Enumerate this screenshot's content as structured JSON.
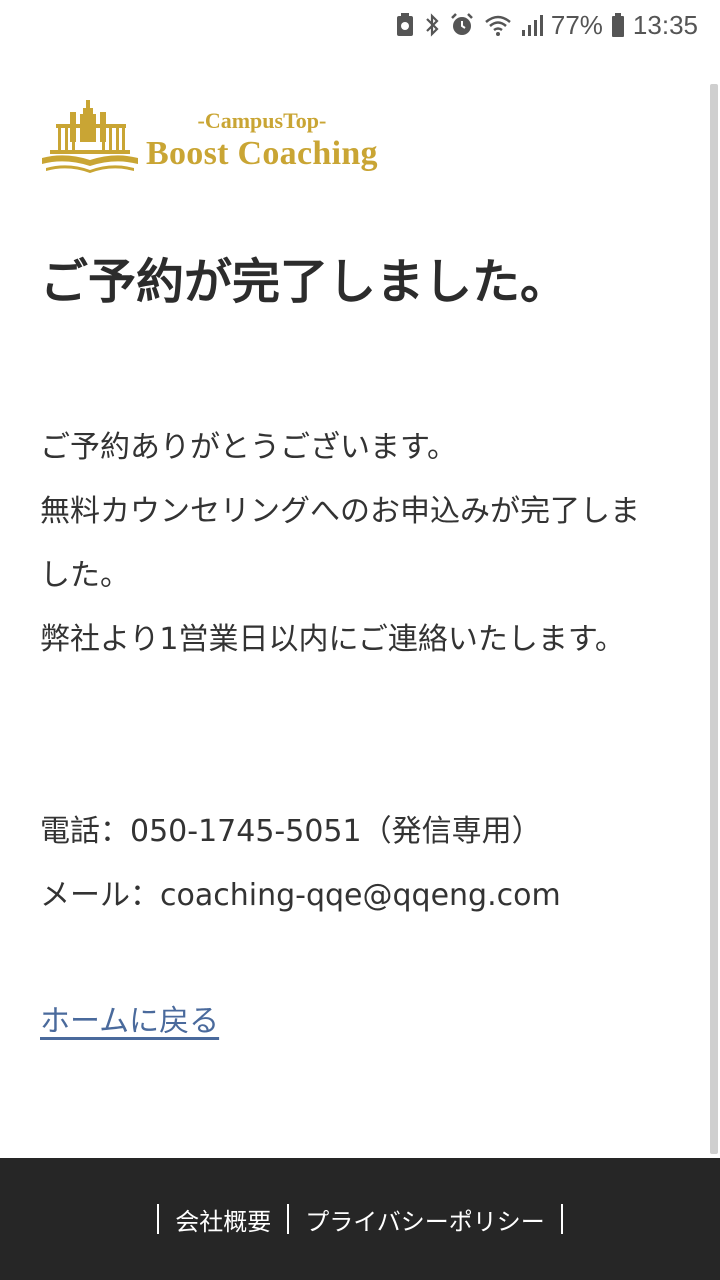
{
  "status_bar": {
    "battery_percent": "77%",
    "time": "13:35"
  },
  "brand": {
    "subtitle": "-CampusTop-",
    "name": "Boost Coaching",
    "color": "#c9a534"
  },
  "headline": "ご予約が完了しました。",
  "message": {
    "lines": [
      "ご予約ありがとうございます。",
      "無料カウンセリングへのお申込みが完了しました。",
      "弊社より1営業日以内にご連絡いたします。"
    ]
  },
  "contact": {
    "phone": "電話：050-1745-5051（発信専用）",
    "email": "メール：coaching-qqe@qqeng.com"
  },
  "home_link": "ホームに戻る",
  "footer": {
    "links": [
      "会社概要",
      "プライバシーポリシー"
    ]
  },
  "colors": {
    "link": "#4a6a9c",
    "footer_bg": "#262626"
  }
}
